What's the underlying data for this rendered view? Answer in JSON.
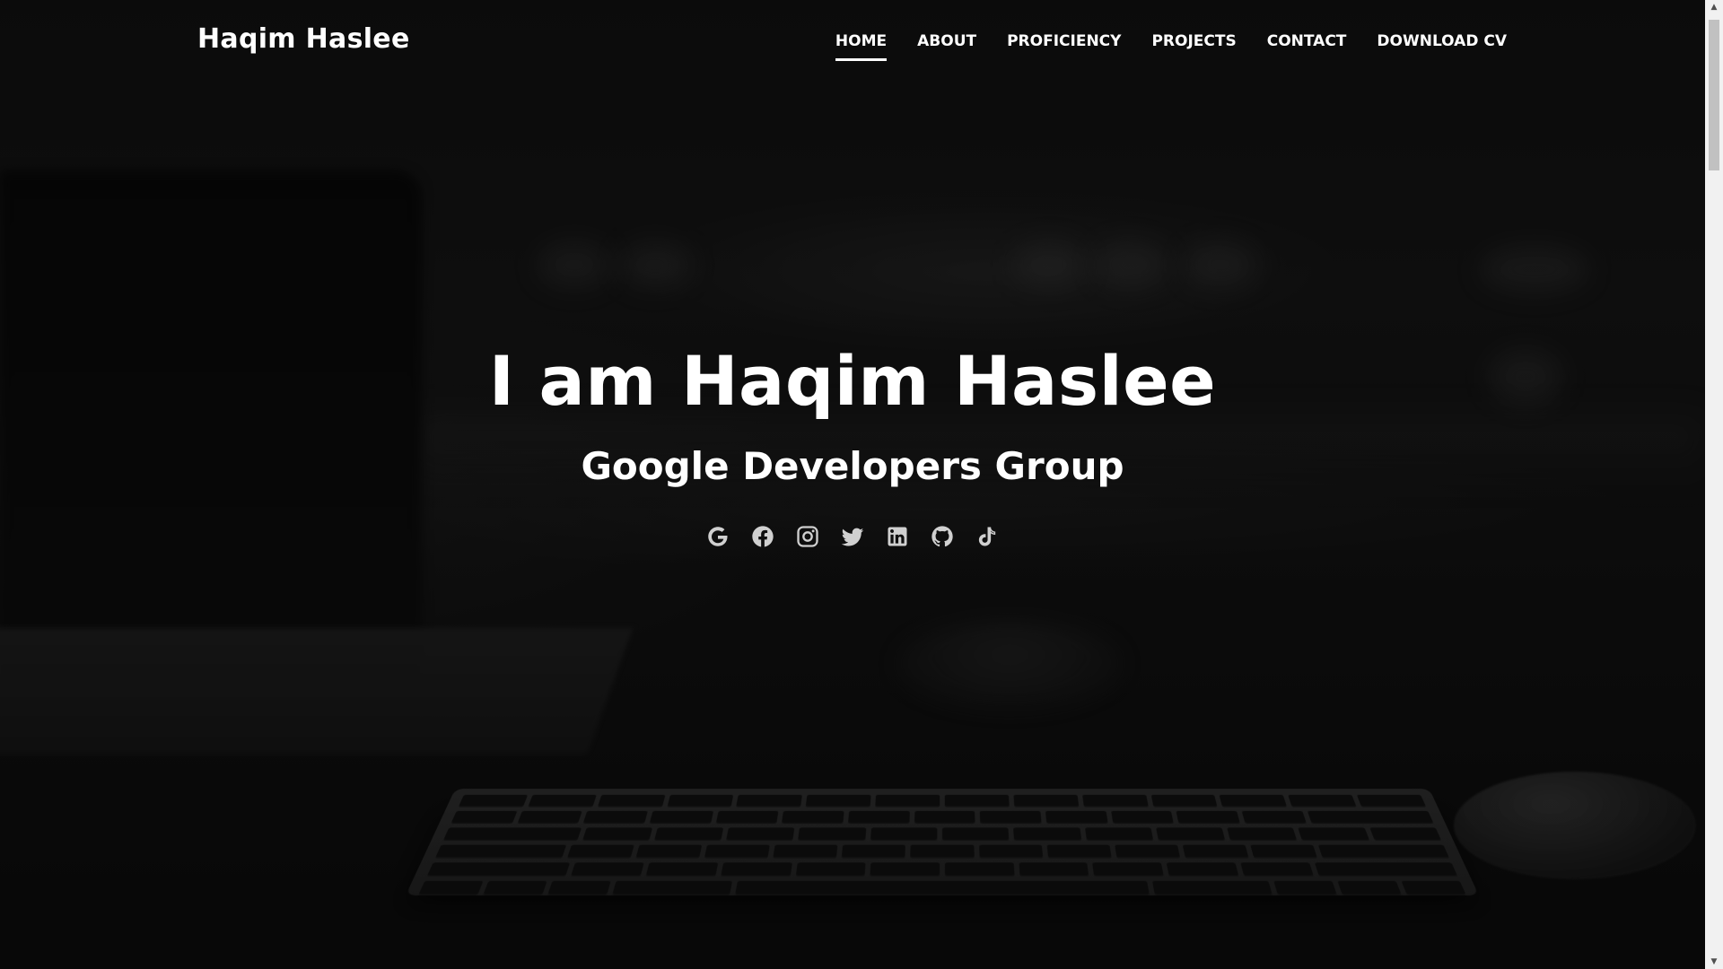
{
  "brand": "Haqim Haslee",
  "nav": {
    "items": [
      {
        "label": "HOME",
        "active": true
      },
      {
        "label": "ABOUT",
        "active": false
      },
      {
        "label": "PROFICIENCY",
        "active": false
      },
      {
        "label": "PROJECTS",
        "active": false
      },
      {
        "label": "CONTACT",
        "active": false
      },
      {
        "label": "DOWNLOAD CV",
        "active": false
      }
    ]
  },
  "hero": {
    "title": "I am Haqim Haslee",
    "subtitle": "Google Developers Group"
  },
  "socials": {
    "icons": [
      "google-icon",
      "facebook-icon",
      "instagram-icon",
      "twitter-icon",
      "linkedin-icon",
      "github-icon",
      "tiktok-icon"
    ]
  },
  "colors": {
    "text": "#ffffff",
    "icon": "#d0d0d0",
    "background": "#121212"
  }
}
